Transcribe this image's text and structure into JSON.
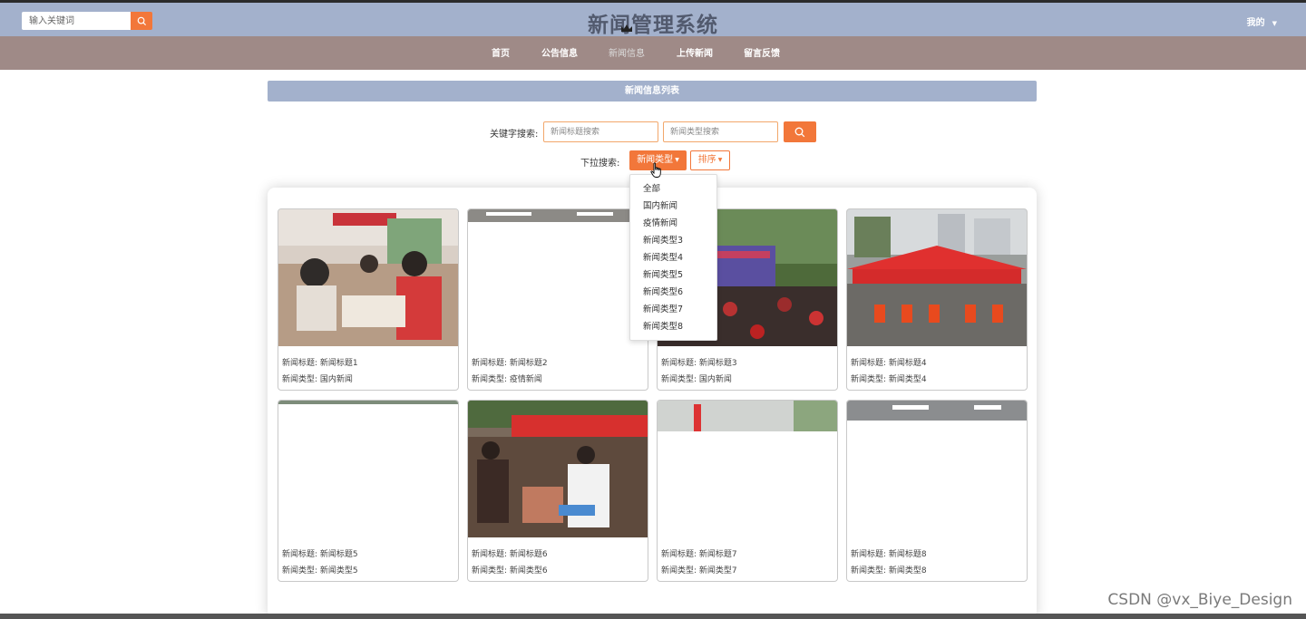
{
  "header": {
    "search_placeholder": "输入关键词",
    "title": "新闻管理系统",
    "user_menu": "我的"
  },
  "nav": {
    "items": [
      {
        "label": "首页"
      },
      {
        "label": "公告信息"
      },
      {
        "label": "新闻信息"
      },
      {
        "label": "上传新闻"
      },
      {
        "label": "留言反馈"
      }
    ],
    "active_index": 2
  },
  "list": {
    "title": "新闻信息列表",
    "keyword_label": "关键字搜索:",
    "title_search_placeholder": "新闻标题搜索",
    "type_search_placeholder": "新闻类型搜索",
    "dropdown_label": "下拉搜索:",
    "type_button": "新闻类型",
    "sort_button": "排序"
  },
  "dropdown": {
    "options": [
      "全部",
      "国内新闻",
      "疫情新闻",
      "新闻类型3",
      "新闻类型4",
      "新闻类型5",
      "新闻类型6",
      "新闻类型7",
      "新闻类型8"
    ]
  },
  "cards": [
    {
      "title": "新闻标题: 新闻标题1",
      "type": "新闻类型: 国内新闻"
    },
    {
      "title": "新闻标题: 新闻标题2",
      "type": "新闻类型: 疫情新闻"
    },
    {
      "title": "新闻标题: 新闻标题3",
      "type": "新闻类型: 国内新闻"
    },
    {
      "title": "新闻标题: 新闻标题4",
      "type": "新闻类型: 新闻类型4"
    },
    {
      "title": "新闻标题: 新闻标题5",
      "type": "新闻类型: 新闻类型5"
    },
    {
      "title": "新闻标题: 新闻标题6",
      "type": "新闻类型: 新闻类型6"
    },
    {
      "title": "新闻标题: 新闻标题7",
      "type": "新闻类型: 新闻类型7"
    },
    {
      "title": "新闻标题: 新闻标题8",
      "type": "新闻类型: 新闻类型8"
    }
  ],
  "watermark": "CSDN @vx_Biye_Design",
  "colors": {
    "header_bg": "#a3b1cc",
    "nav_bg": "#9f8a87",
    "accent": "#f2773a"
  }
}
